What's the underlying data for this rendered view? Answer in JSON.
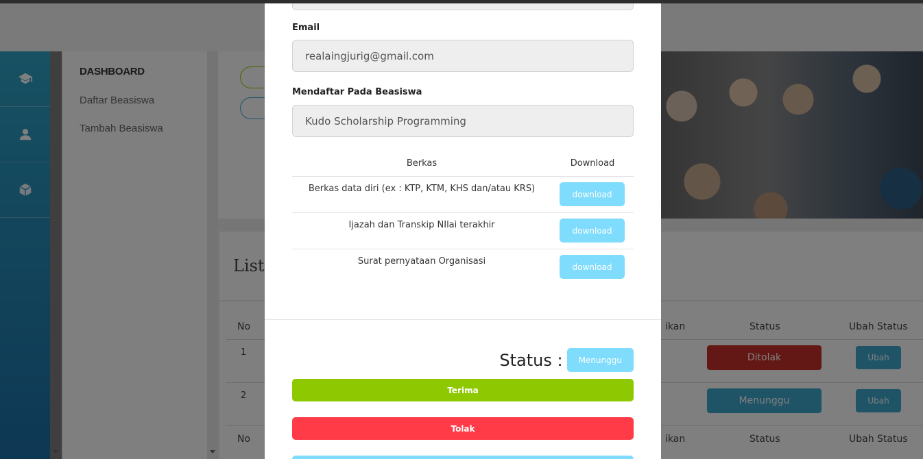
{
  "sidebar": {
    "heading": "DASHBOARD",
    "items": [
      {
        "label": "Daftar Beasiswa"
      },
      {
        "label": "Tambah Beasiswa"
      }
    ]
  },
  "nav_icons": [
    "graduation-cap-icon",
    "user-icon",
    "cube-icon"
  ],
  "list_title": "List",
  "bg_table": {
    "headers": {
      "no": "No",
      "pendidikan_partial": "ikan",
      "status": "Status",
      "ubah_status": "Ubah Status"
    },
    "rows": [
      {
        "no": "1",
        "status": "Ditolak",
        "status_color": "#c9302c",
        "ubah": "Ubah"
      },
      {
        "no": "2",
        "status": "Menunggu",
        "status_color": "#3fa8cf",
        "ubah": "Ubah"
      }
    ],
    "footer_headers": {
      "no": "No",
      "pendidikan_partial": "ikan",
      "status": "Status",
      "ubah_status": "Ubah Status"
    }
  },
  "modal": {
    "email_label": "Email",
    "email_value": "realaingjurig@gmail.com",
    "beasiswa_label": "Mendaftar Pada Beasiswa",
    "beasiswa_value": "Kudo Scholarship Programming",
    "berkas_table": {
      "headers": {
        "berkas": "Berkas",
        "download": "Download"
      },
      "rows": [
        {
          "name": "Berkas data diri (ex : KTP, KTM, KHS dan/atau KRS)",
          "button": "download"
        },
        {
          "name": "Ijazah dan Transkip NIlai terakhir",
          "button": "download"
        },
        {
          "name": "Surat pernyataan Organisasi",
          "button": "download"
        }
      ]
    },
    "status_label": "Status :",
    "status_value": "Menunggu",
    "buttons": {
      "terima": "Terima",
      "tolak": "Tolak"
    },
    "colors": {
      "terima": "#8dc800",
      "tolak": "#ff3b47",
      "info": "#7fdcfc"
    }
  }
}
